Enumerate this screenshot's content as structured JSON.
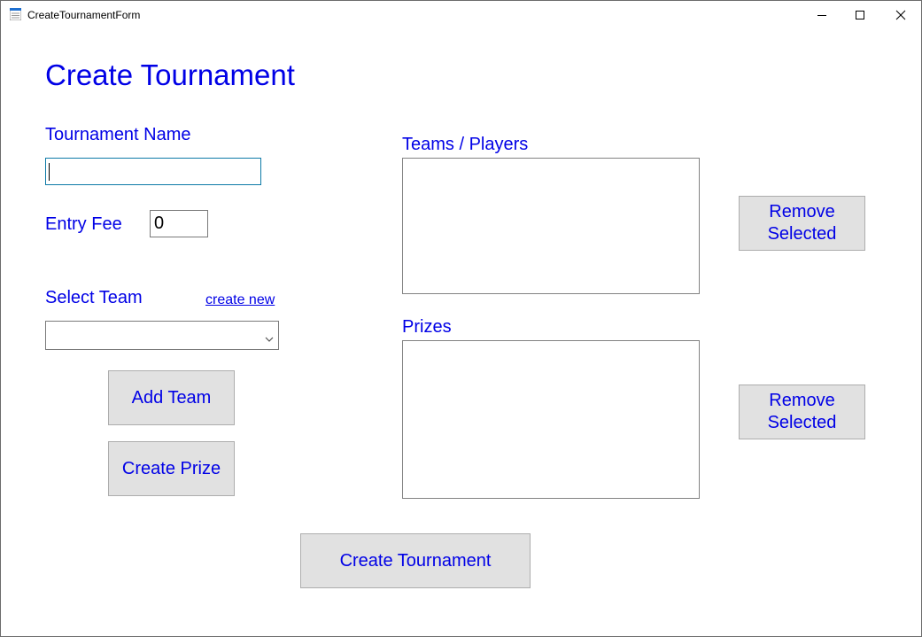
{
  "window": {
    "title": "CreateTournamentForm",
    "controls": {
      "minimize_icon": "minimize-icon",
      "maximize_icon": "maximize-icon",
      "close_icon": "close-icon"
    }
  },
  "form": {
    "heading": "Create Tournament",
    "tournament_name_label": "Tournament Name",
    "tournament_name_value": "",
    "entry_fee_label": "Entry Fee",
    "entry_fee_value": "0",
    "select_team_label": "Select Team",
    "create_new_link": "create new",
    "select_team_value": "",
    "add_team_button": "Add Team",
    "create_prize_button": "Create Prize",
    "teams_players_label": "Teams / Players",
    "prizes_label": "Prizes",
    "remove_selected_teams_button": "Remove Selected",
    "remove_selected_prizes_button": "Remove Selected",
    "create_tournament_button": "Create Tournament"
  },
  "colors": {
    "label_text": "#0000e6",
    "button_bg": "#e1e1e1",
    "button_border": "#adadad",
    "focus_border": "#0d7aa7"
  }
}
